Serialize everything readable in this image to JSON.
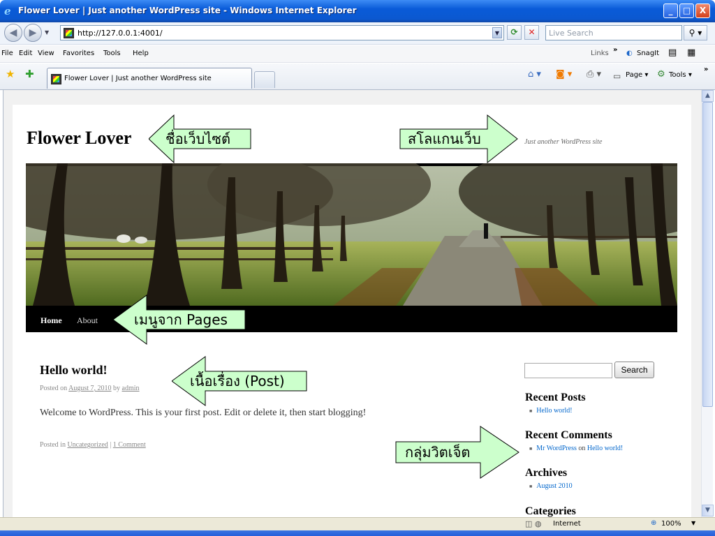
{
  "window": {
    "title": "Flower Lover | Just another WordPress site - Windows Internet Explorer",
    "buttons": [
      "_",
      "□",
      "X"
    ]
  },
  "navbar": {
    "back_icon": "back-arrow-icon",
    "forward_icon": "forward-arrow-icon",
    "address": "http://127.0.0.1:4001/",
    "search_placeholder": "Live Search"
  },
  "menubar": {
    "items": [
      "File",
      "Edit",
      "View",
      "Favorites",
      "Tools",
      "Help"
    ],
    "links": "Links",
    "snagit": "SnagIt"
  },
  "favbar": {
    "tab_label": "Flower Lover | Just another WordPress site",
    "page_label": "Page",
    "tools_label": "Tools"
  },
  "site": {
    "title": "Flower Lover",
    "tagline": "Just another WordPress site",
    "nav": [
      "Home",
      "About"
    ]
  },
  "post": {
    "title": "Hello world!",
    "posted_on": "Posted on",
    "date": "August 7, 2010",
    "by": "by",
    "author": "admin",
    "content": "Welcome to WordPress. This is your first post. Edit or delete it, then start blogging!",
    "posted_in": "Posted in",
    "category": "Uncategorized",
    "separator": "|",
    "comments": "1 Comment"
  },
  "sidebar": {
    "search_button": "Search",
    "recent_posts_title": "Recent Posts",
    "recent_posts": [
      "Hello world!"
    ],
    "recent_comments_title": "Recent Comments",
    "comment_author": "Mr WordPress",
    "comment_on": "on",
    "comment_post": "Hello world!",
    "archives_title": "Archives",
    "archives": [
      "August 2010"
    ],
    "categories_title": "Categories"
  },
  "annotations": {
    "site_name": "ชื่อเว็บไซต์",
    "slogan": "สโลแกนเว็บ",
    "menu": "เมนูจาก Pages",
    "content": "เนื้อเรื่อง (Post)",
    "widgets": "กลุ่มวิตเจ็ต"
  },
  "status": {
    "zone": "Internet",
    "zoom": "100%"
  },
  "colors": {
    "annotation_fill": "#ccffcc",
    "link": "#0066cc",
    "titlebar": "#0a5bd8"
  }
}
